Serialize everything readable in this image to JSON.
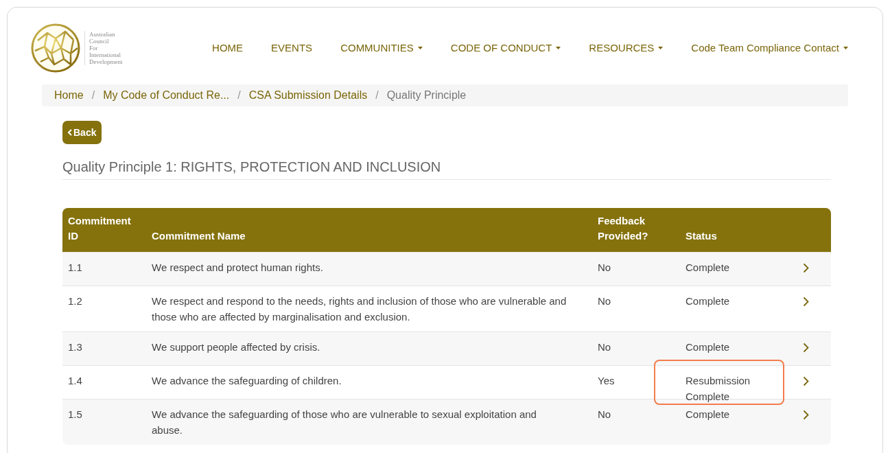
{
  "logo": {
    "lines": [
      "Australian",
      "Council",
      "For",
      "International",
      "Development"
    ]
  },
  "nav": [
    {
      "label": "HOME",
      "has_menu": false
    },
    {
      "label": "EVENTS",
      "has_menu": false
    },
    {
      "label": "COMMUNITIES",
      "has_menu": true
    },
    {
      "label": "CODE OF CONDUCT",
      "has_menu": true
    },
    {
      "label": "RESOURCES",
      "has_menu": true
    },
    {
      "label": "Code Team Compliance Contact",
      "has_menu": true
    }
  ],
  "breadcrumb_separator": "/",
  "breadcrumb": [
    {
      "label": "Home",
      "current": false
    },
    {
      "label": "My Code of Conduct Re...",
      "current": false
    },
    {
      "label": "CSA Submission Details",
      "current": false
    },
    {
      "label": "Quality Principle",
      "current": true
    }
  ],
  "back_button": "Back",
  "heading": "Quality Principle 1: RIGHTS, PROTECTION AND INCLUSION",
  "table": {
    "columns": [
      [
        "Commitment",
        "ID"
      ],
      [
        "Commitment Name"
      ],
      [
        "Feedback",
        "Provided?"
      ],
      [
        "Status"
      ]
    ],
    "rows": [
      {
        "id": "1.1",
        "name": "We respect and protect human rights.",
        "feedback": "No",
        "status": [
          "Complete"
        ],
        "highlighted": false
      },
      {
        "id": "1.2",
        "name": "We respect and respond to the needs, rights and inclusion of those who are vulnerable and those who are affected by marginalisation and exclusion.",
        "feedback": "No",
        "status": [
          "Complete"
        ],
        "highlighted": false
      },
      {
        "id": "1.3",
        "name": "We support people affected by crisis.",
        "feedback": "No",
        "status": [
          "Complete"
        ],
        "highlighted": false
      },
      {
        "id": "1.4",
        "name": "We advance the safeguarding of children.",
        "feedback": "Yes",
        "status": [
          "Resubmission",
          "Complete"
        ],
        "highlighted": true
      },
      {
        "id": "1.5",
        "name": "We advance the safeguarding of those who are vulnerable to sexual exploitation and abuse.",
        "feedback": "No",
        "status": [
          "Complete"
        ],
        "highlighted": false
      }
    ]
  }
}
